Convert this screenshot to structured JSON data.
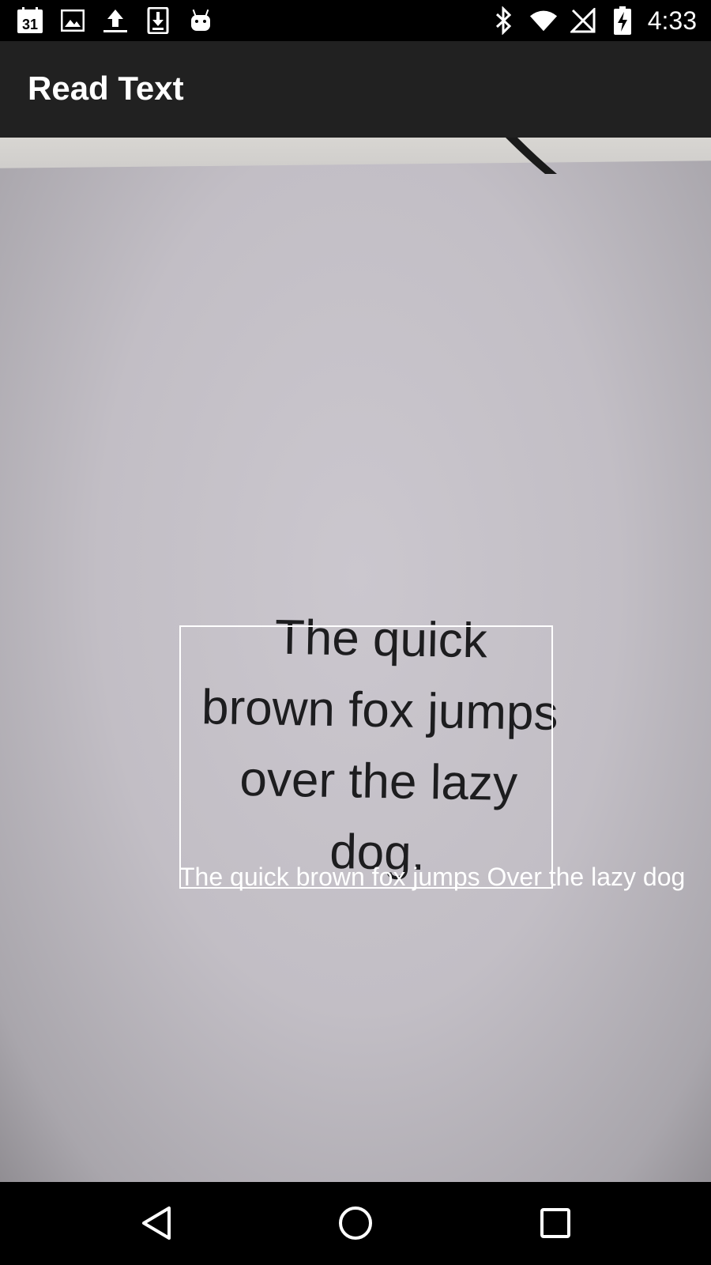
{
  "status_bar": {
    "time": "4:33",
    "left_icons": [
      "calendar-icon",
      "image-icon",
      "upload-icon",
      "download-icon",
      "android-icon"
    ],
    "calendar_day": "31",
    "right_icons": [
      "bluetooth-icon",
      "wifi-icon",
      "no-signal-icon",
      "battery-charging-icon"
    ]
  },
  "app_bar": {
    "title": "Read Text"
  },
  "camera": {
    "printed_text_lines": [
      "The quick",
      "brown fox jumps",
      "over the lazy",
      "dog."
    ],
    "ocr_result": "The quick brown fox jumps Over the lazy dog"
  },
  "nav_bar": {
    "buttons": [
      "back-icon",
      "home-icon",
      "recents-icon"
    ]
  },
  "colors": {
    "status_bar_bg": "#000000",
    "app_bar_bg": "#212121",
    "overlay": "#ffffff"
  }
}
